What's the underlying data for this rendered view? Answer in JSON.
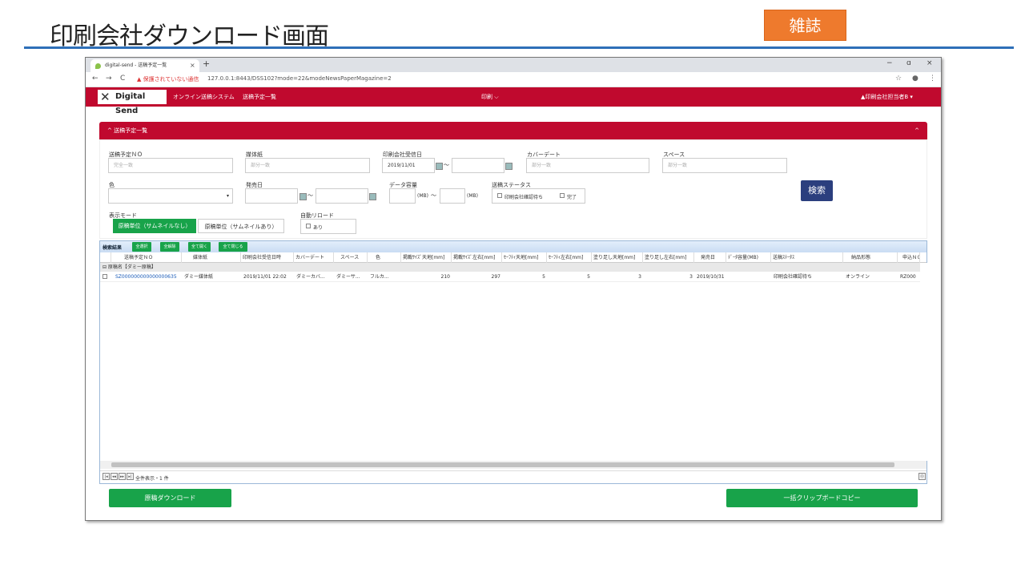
{
  "slide": {
    "title": "印刷会社ダウンロード画面",
    "badge": "雑誌",
    "accent_color": "#2e6fb8",
    "badge_color": "#ee7a2d"
  },
  "browser": {
    "tab_title": "digital-send - 送稿予定一覧",
    "tab_close": "×",
    "new_tab": "+",
    "minimize": "−",
    "maximize": "ɑ",
    "close": "×",
    "back": "←",
    "forward": "→",
    "reload": "C",
    "security_warning": "▲ 保護されていない通信",
    "url": "127.0.0.1:8443/DSS102?mode=22&modeNewsPaperMagazine=2",
    "bookmark_icon": "☆",
    "profile_icon": "●",
    "menu_icon": "⋮"
  },
  "app": {
    "brand_color": "#c0092e",
    "logo_mark": "✕",
    "logo_text": "Digital Send",
    "system_name": "オンライン送稿システム",
    "page_link": "送稿予定一覧",
    "menu_center": "印刷 ⌵",
    "user": "▲印刷会社担当者B ▾"
  },
  "panel": {
    "title": "^ 送稿予定一覧",
    "collapse": "^",
    "fields": {
      "send_no_label": "送稿予定ＮＯ",
      "send_no_placeholder": "完全一致",
      "media_label": "媒体紙",
      "media_placeholder": "部分一致",
      "received_label": "印刷会社受信日",
      "received_from": "2019/11/01",
      "range_sep": "〜",
      "cover_label": "カバーデート",
      "cover_placeholder": "部分一致",
      "space_label": "スペース",
      "space_placeholder": "部分一致",
      "color_label": "色",
      "color_arrow": "▾",
      "release_label": "発売日",
      "data_label": "データ容量",
      "unit_mb": "(MB)",
      "status_label": "送稿ステータス",
      "status_opt1": "印刷会社確認待ち",
      "status_opt2": "完了",
      "mode_label": "表示モード",
      "mode_on": "原稿単位（サムネイルなし）",
      "mode_off": "原稿単位（サムネイルあり）",
      "reload_label": "自動リロード",
      "reload_opt": "あり"
    },
    "search_button": "検索"
  },
  "results": {
    "title": "検索結果",
    "buttons": [
      "全選択",
      "全解除",
      "全て開く",
      "全て閉じる"
    ],
    "columns": [
      "送稿予定ＮＯ",
      "媒体紙",
      "印刷会社受信日時",
      "カバーデート",
      "スペース",
      "色",
      "掲載ｻｲｽﾞ天地[mm]",
      "掲載ｻｲｽﾞ左右[mm]",
      "ｾｰﾌﾃｨ天地[mm]",
      "ｾｰﾌﾃｨ左右[mm]",
      "塗り足し天地[mm]",
      "塗り足し左右[mm]",
      "発売日",
      "ﾃﾞｰﾀ容量(MB)",
      "送稿ｽﾃｰﾀｽ",
      "納品形態",
      "申込ＮＯ"
    ],
    "group": "⊟  原稿名【ダミー原稿】",
    "row": {
      "send_no": "SZ000000000000000635",
      "media": "ダミー媒体紙",
      "received": "2019/11/01 22:02",
      "cover": "ダミーカバ...",
      "space": "ダミーサ...",
      "color": "フルカ...",
      "size_tb": "210",
      "size_lr": "297",
      "safety_tb": "5",
      "safety_lr": "5",
      "bleed_tb": "3",
      "bleed_lr": "3",
      "release": "2019/10/31",
      "data_mb": "",
      "status": "印刷会社確認待ち",
      "delivery": "オンライン",
      "apply_no": "RZ000"
    },
    "pager_first": "|◂",
    "pager_prev": "◂◂",
    "pager_next": "▸▸",
    "pager_last": "▸|",
    "pager_info": "全件表示・1 件",
    "info_icon": "⓪"
  },
  "actions": {
    "download": "原稿ダウンロード",
    "copy": "一括クリップボードコピー"
  }
}
